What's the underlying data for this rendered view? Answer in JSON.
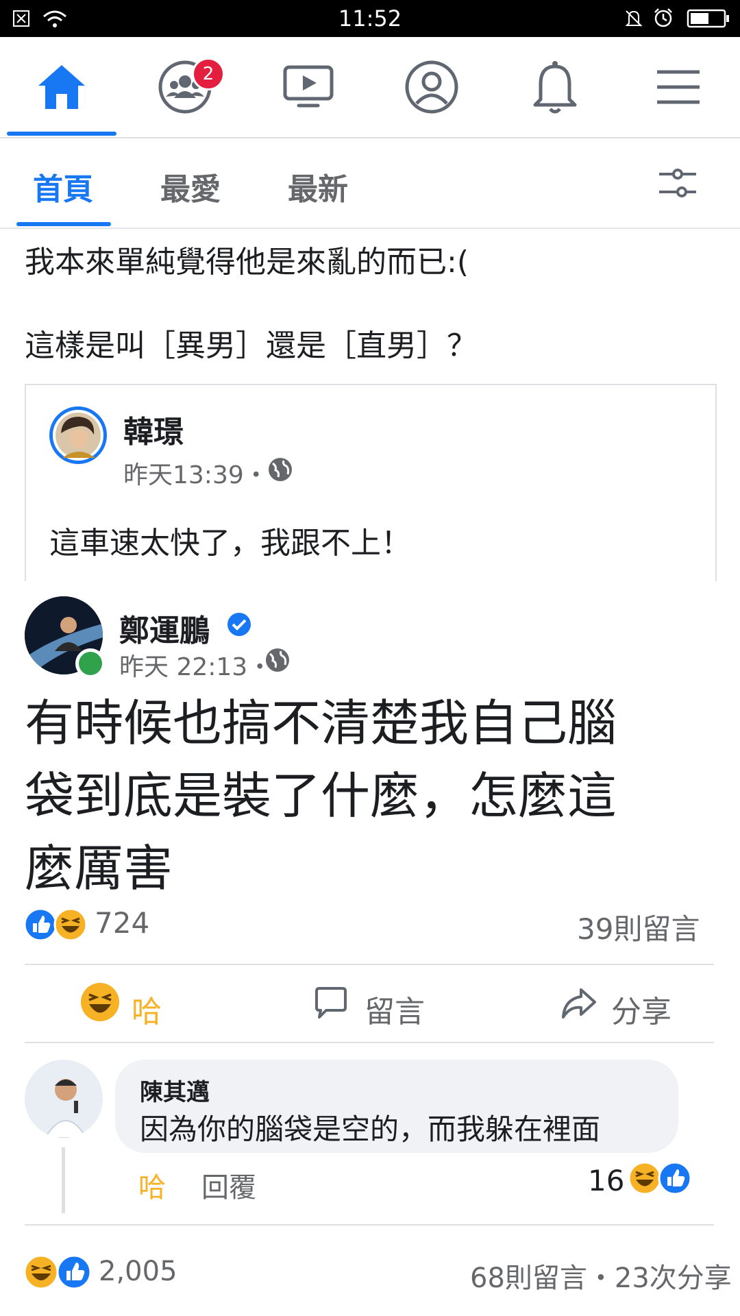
{
  "status_bar": {
    "time": "11:52"
  },
  "nav": {
    "items": [
      "home-icon",
      "groups-icon",
      "watch-icon",
      "profile-icon",
      "notifications-icon",
      "menu-icon"
    ],
    "groups_badge": "2"
  },
  "tabs": {
    "home": "首頁",
    "favorites": "最愛",
    "recent": "最新"
  },
  "post": {
    "text_line1": "我本來單純覺得他是來亂的而已:(",
    "text_line2": "這樣是叫［異男］還是［直男］？",
    "shared_post": {
      "author": "韓璟",
      "time": "昨天13:39・",
      "text": "這車速太快了，我跟不上！"
    },
    "inner_post": {
      "author": "鄭運鵬",
      "time": "昨天 22:13・",
      "text_line1": "有時候也搞不清楚我自己腦",
      "text_line2": "袋到底是裝了什麼，怎麼這",
      "text_line3": "麼厲害",
      "reaction_count": "724",
      "comment_count": "39則留言",
      "actions": {
        "haha": "哈",
        "comment": "留言",
        "share": "分享"
      },
      "comment": {
        "author": "陳其邁",
        "text": "因為你的腦袋是空的，而我躲在裡面",
        "haha": "哈",
        "reply": "回覆",
        "reaction_count": "16"
      }
    },
    "footer": {
      "reaction_count": "2,005",
      "comments_shares": "68則留言・23次分享"
    }
  },
  "colors": {
    "brand": "#1877f2",
    "haha": "#f7b125",
    "badge": "#e41e3f",
    "online": "#31a24c"
  }
}
